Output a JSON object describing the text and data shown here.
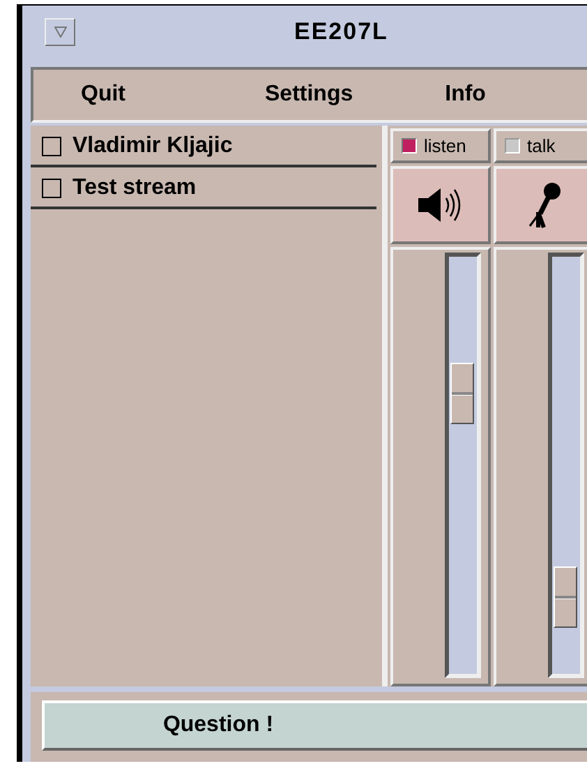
{
  "window": {
    "title": "EE207L"
  },
  "menu": [
    {
      "label": "Quit"
    },
    {
      "label": "Settings"
    },
    {
      "label": "Info"
    }
  ],
  "streams": [
    {
      "name": "Vladimir Kljajic",
      "checked": false
    },
    {
      "name": "Test stream",
      "checked": false
    }
  ],
  "channels": [
    {
      "kind": "speaker",
      "label": "listen",
      "checked": true,
      "level": 0.7
    },
    {
      "kind": "microphone",
      "label": "talk",
      "checked": false,
      "level": 0.13
    }
  ],
  "question_button": "Question !"
}
